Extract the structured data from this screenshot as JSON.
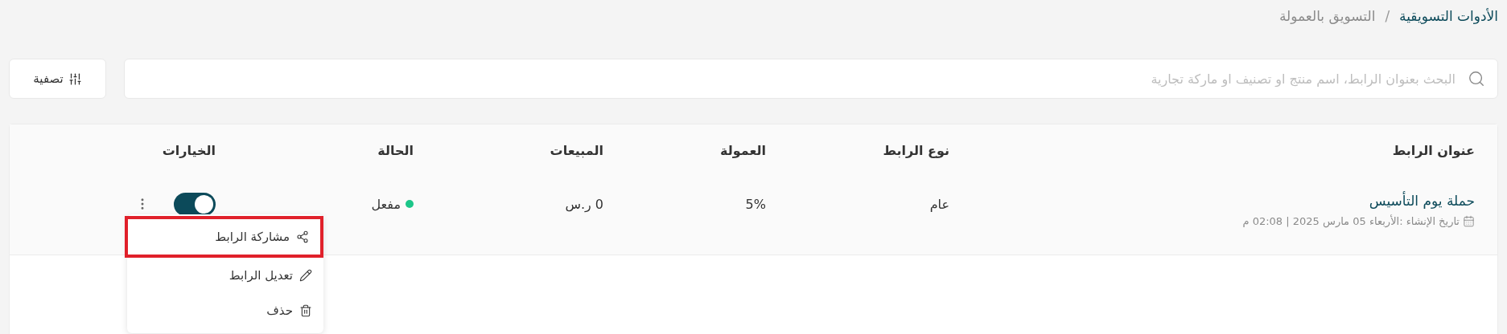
{
  "breadcrumb": [
    {
      "label": "الأدوات التسويقية",
      "current": false
    },
    {
      "label": "التسويق بالعمولة",
      "current": true
    }
  ],
  "breadcrumb_separator": "/",
  "search": {
    "placeholder": "البحث بعنوان الرابط، اسم منتج او تصنيف او ماركة تجارية"
  },
  "filter_button": {
    "label": "تصفية"
  },
  "table": {
    "columns": [
      "عنوان الرابط",
      "نوع الرابط",
      "العمولة",
      "المبيعات",
      "الحالة",
      "الخيارات"
    ],
    "rows": [
      {
        "title": "حملة يوم التأسيس",
        "created": "تاريخ الإنشاء :الأربعاء 05 مارس 2025 | 02:08 م",
        "type": "عام",
        "commission": "5%",
        "sales": "0 ر.س",
        "status": "مفعل",
        "color": "#1cc689",
        "enabled": true
      }
    ]
  },
  "menu": {
    "items": [
      {
        "kind": "share",
        "label": "مشاركة الرابط",
        "highlighted": true
      },
      {
        "kind": "edit",
        "label": "تعديل الرابط",
        "highlighted": false
      },
      {
        "kind": "delete",
        "label": "حذف",
        "highlighted": false
      }
    ]
  }
}
